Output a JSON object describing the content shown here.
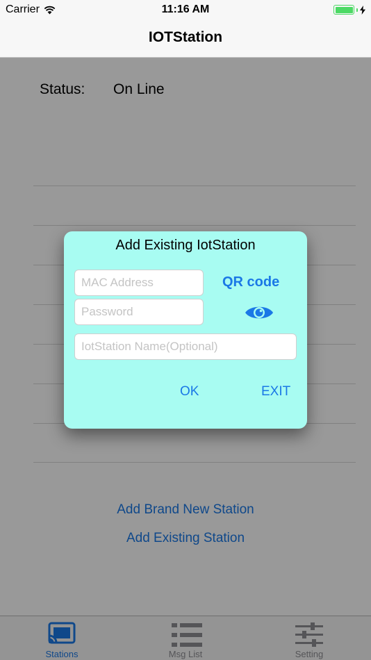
{
  "status_bar": {
    "carrier": "Carrier",
    "time": "11:16 AM"
  },
  "nav": {
    "title": "IOTStation"
  },
  "main": {
    "status_label": "Status:",
    "status_value": "On Line",
    "add_brand_new": "Add Brand New Station",
    "add_existing": "Add Existing Station"
  },
  "dialog": {
    "title": "Add Existing IotStation",
    "mac_placeholder": "MAC Address",
    "password_placeholder": "Password",
    "name_placeholder": "IotStation Name(Optional)",
    "qr_label": "QR code",
    "show_password_icon": "eye-icon",
    "ok_label": "OK",
    "exit_label": "EXIT"
  },
  "tabs": [
    {
      "label": "Stations",
      "icon": "cast-icon",
      "selected": true
    },
    {
      "label": "Msg List",
      "icon": "list-icon",
      "selected": false
    },
    {
      "label": "Setting",
      "icon": "sliders-icon",
      "selected": false
    }
  ],
  "colors": {
    "accent": "#1a78e6",
    "dialog_bg": "#a8fcf2",
    "battery": "#4cd964",
    "tab_inactive": "#8e8e93"
  }
}
